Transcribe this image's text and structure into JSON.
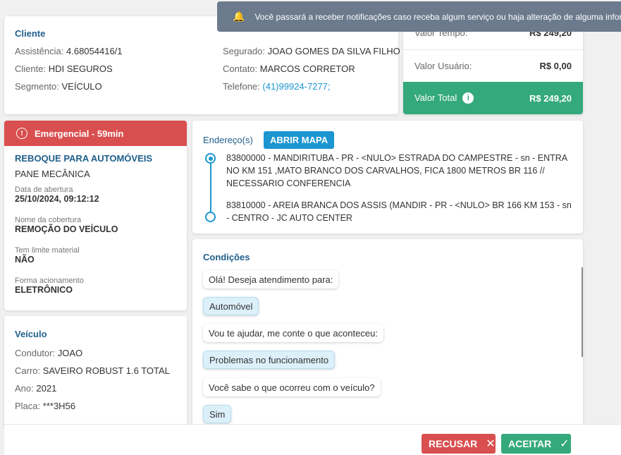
{
  "toast": {
    "icon": "bell-icon",
    "text": "Você passará a receber notificações caso receba algum serviço ou haja alteração de alguma informação"
  },
  "client": {
    "title": "Cliente",
    "assistencia_label": "Assistência:",
    "assistencia": "4.68054416/1",
    "cliente_label": "Cliente:",
    "cliente": "HDI SEGUROS",
    "segmento_label": "Segmento:",
    "segmento": "VEÍCULO",
    "segurado_label": "Segurado:",
    "segurado": "JOAO GOMES DA SILVA FILHO",
    "contato_label": "Contato:",
    "contato": "MARCOS CORRETOR",
    "telefone_label": "Telefone:",
    "telefone": "(41)99924-7277;"
  },
  "values": {
    "tempo_label": "Valor Tempo:",
    "tempo": "R$ 249,20",
    "usuario_label": "Valor Usuário:",
    "usuario": "R$ 0,00",
    "total_label": "Valor Total",
    "total": "R$ 249,20"
  },
  "service": {
    "badge": "Emergencial - 59min",
    "type": "REBOQUE PARA AUTOMÓVEIS",
    "problem": "PANE MECÂNICA",
    "fields": [
      {
        "label": "Data de abertura",
        "value": "25/10/2024, 09:12:12"
      },
      {
        "label": "Nome da cobertura",
        "value": "REMOÇÃO DO VEÍCULO"
      },
      {
        "label": "Tem limite material",
        "value": "NÃO"
      },
      {
        "label": "Forma acionamento",
        "value": "ELETRÔNICO"
      }
    ]
  },
  "vehicle": {
    "title": "Veículo",
    "condutor_label": "Condutor:",
    "condutor": "JOAO",
    "carro_label": "Carro:",
    "carro": "SAVEIRO ROBUST 1.6 TOTAL",
    "ano_label": "Ano:",
    "ano": "2021",
    "placa_label": "Placa:",
    "placa": "***3H56"
  },
  "address": {
    "title": "Endereço(s)",
    "map_button": "ABRIR MAPA",
    "items": [
      "83800000 - MANDIRITUBA - PR - <NULO> ESTRADA DO CAMPESTRE - sn - ENTRA NO KM 151 ,MATO BRANCO DOS CARVALHOS, FICA 1800 METROS BR 116 // NECESSARIO CONFERENCIA",
      "83810000 - AREIA BRANCA DOS ASSIS (MANDIR - PR - <NULO> BR 166 KM 153 - sn - CENTRO - JC AUTO CENTER"
    ]
  },
  "conditions": {
    "title": "Condições",
    "messages": [
      "Olá! Deseja atendimento para:",
      "Automóvel",
      "Vou te ajudar, me conte o que aconteceu:",
      "Problemas no funcionamento",
      "Você sabe o que ocorreu com o veículo?",
      "Sim"
    ]
  },
  "footer": {
    "refuse": "RECUSAR",
    "accept": "ACEITAR"
  },
  "colors": {
    "accent": "#1b96d1",
    "danger": "#d94f4f",
    "success": "#34a97b",
    "heading": "#1f5f8b",
    "toast": "#6b7a8d"
  }
}
